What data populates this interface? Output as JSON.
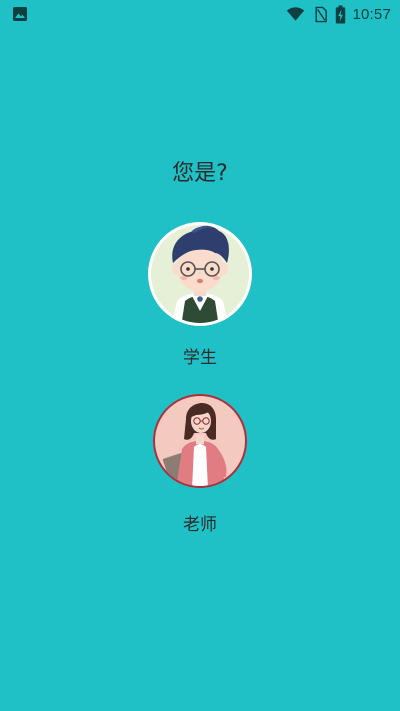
{
  "status_bar": {
    "left_icon": "image-icon",
    "icons": [
      "wifi-icon",
      "no-sim-icon",
      "battery-charging-icon"
    ],
    "time": "10:57"
  },
  "prompt": {
    "title": "您是?"
  },
  "roles": [
    {
      "label": "学生",
      "avatar": "student-avatar"
    },
    {
      "label": "老师",
      "avatar": "teacher-avatar"
    }
  ],
  "colors": {
    "background": "#20C1C6",
    "status_icon": "#0c3f41",
    "text": "#2a2a2a"
  }
}
